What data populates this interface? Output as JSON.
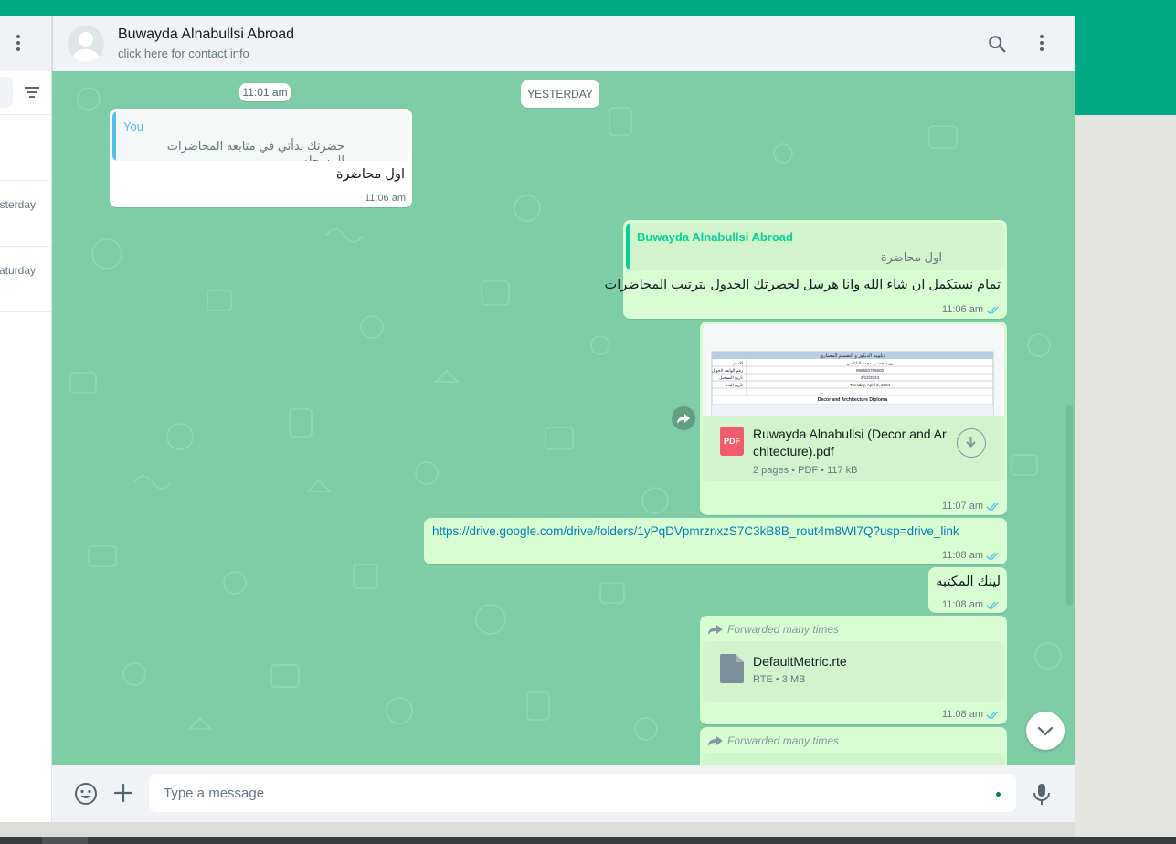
{
  "sidebar": {
    "chats": [
      {
        "time": "Yesterday"
      },
      {
        "time": "Saturday"
      }
    ]
  },
  "header": {
    "contact_name": "Buwayda Alnabullsi Abroad",
    "subtitle": "click here for contact info"
  },
  "chat": {
    "day_separator": "YESTERDAY",
    "partial_time": "11:01 am",
    "messages": [
      {
        "direction": "incoming",
        "quote_author": "You",
        "quote_text": "حضرتك بدأتي في متابعه المحاضرات المسجله",
        "text": "اول محاضرة",
        "time": "11:06 am"
      },
      {
        "direction": "outgoing",
        "quote_author": "Buwayda Alnabullsi Abroad",
        "quote_text": "اول محاضرة",
        "text": "تمام نستكمل ان شاء الله وانا هرسل لحضرتك الجدول بترتيب المحاضرات",
        "time": "11:06 am"
      },
      {
        "direction": "outgoing",
        "type": "document",
        "preview": {
          "header_line": "دبلومة الديكور و التصميم المعماري",
          "rows": [
            {
              "label": "الاسم",
              "value": "رويدا حسني محمد النابلسي"
            },
            {
              "label": "رقم الهاتف الجوال",
              "value": "966550765600"
            },
            {
              "label": "تاريخ التسجيل",
              "value": "2/12/2024"
            },
            {
              "label": "تاريخ البدء",
              "value": "Tuesday, April 2, 2024"
            }
          ],
          "section_title": "Decor and Architecture Diploma"
        },
        "file_name_line1": "Ruwayda Alnabullsi (Decor and Ar",
        "file_name_line2": "chitecture).pdf",
        "file_meta": "2 pages • PDF • 117 kB",
        "icon_label": "PDF",
        "time": "11:07 am"
      },
      {
        "direction": "outgoing",
        "type": "link",
        "text": "https://drive.google.com/drive/folders/1yPqDVpmrznxzS7C3kB8B_rout4m8WI7Q?usp=drive_link",
        "time": "11:08 am"
      },
      {
        "direction": "outgoing",
        "text": "لينك المكتبه",
        "time": "11:08 am"
      },
      {
        "direction": "outgoing",
        "type": "document",
        "forwarded_label": "Forwarded many times",
        "file_name": "DefaultMetric.rte",
        "file_meta": "RTE • 3 MB",
        "time": "11:08 am"
      },
      {
        "direction": "outgoing",
        "type": "document",
        "forwarded_label": "Forwarded many times"
      }
    ]
  },
  "composer": {
    "placeholder": "Type a message"
  },
  "colors": {
    "brand": "#00a884",
    "chat_background": "#7ecda6",
    "outgoing_bubble": "#d9fdd3",
    "incoming_bubble": "#ffffff",
    "link": "#027eb5",
    "read_ticks": "#53bdeb",
    "quote_you": "#53bdeb",
    "quote_contact": "#06cf9c"
  },
  "icons": [
    "menu-kebab-icon",
    "filter-icon",
    "search-icon",
    "avatar-icon",
    "pdf-icon",
    "download-icon",
    "forward-icon",
    "file-icon",
    "chevron-down-icon",
    "emoji-icon",
    "plus-icon",
    "mic-icon",
    "read-ticks-icon"
  ]
}
